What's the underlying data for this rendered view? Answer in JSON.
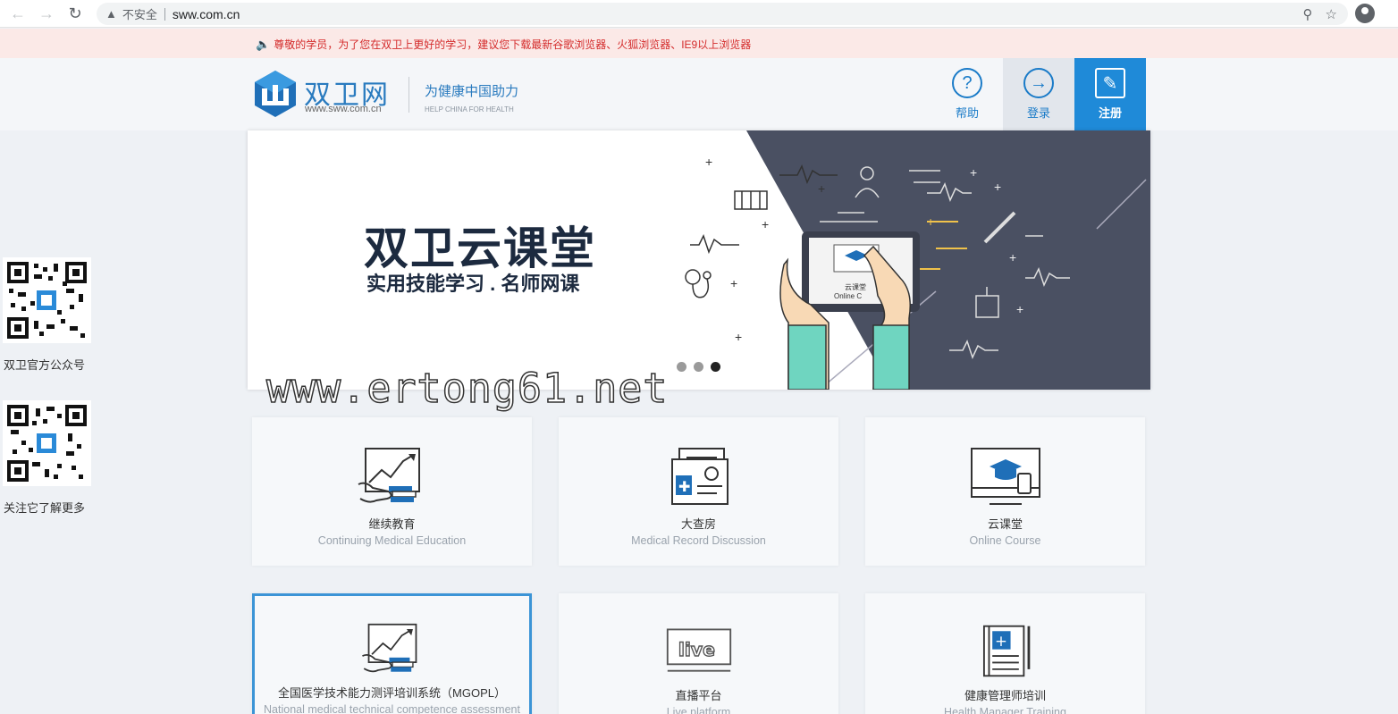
{
  "browser": {
    "insecure_label": "不安全",
    "url": "sww.com.cn"
  },
  "notice": {
    "text": "尊敬的学员，为了您在双卫上更好的学习，建议您下载最新谷歌浏览器、火狐浏览器、IE9以上浏览器"
  },
  "header": {
    "logo_name": "双卫网",
    "logo_url": "www.sww.com.cn",
    "slogan": "为健康中国助力",
    "slogan_en": "HELP CHINA FOR HEALTH",
    "buttons": {
      "help": "帮助",
      "login": "登录",
      "register": "注册"
    }
  },
  "banner": {
    "title": "双卫云课堂",
    "subtitle": "实用技能学习 . 名师网课",
    "tablet_label": "云课堂",
    "tablet_label_en": "Online C",
    "slide_count": 3,
    "active_slide": 3
  },
  "watermark": "www.ertong61.net",
  "sidebar": {
    "qr1_label": "双卫官方公众号",
    "qr2_label": "关注它了解更多"
  },
  "cards": [
    {
      "title": "继续教育",
      "subtitle": "Continuing Medical Education",
      "icon": "chart-hand-books-icon"
    },
    {
      "title": "大查房",
      "subtitle": "Medical Record Discussion",
      "icon": "medical-record-icon"
    },
    {
      "title": "云课堂",
      "subtitle": "Online Course",
      "icon": "monitor-graduation-cap-icon"
    },
    {
      "title": "全国医学技术能力测评培训系统（MGOPL）",
      "subtitle": "National medical technical competence assessment",
      "icon": "chart-hand-books-icon"
    },
    {
      "title": "直播平台",
      "subtitle": "Live platform",
      "icon": "live-tv-icon"
    },
    {
      "title": "健康管理师培训",
      "subtitle": "Health Manager Training",
      "icon": "health-notebook-icon"
    }
  ],
  "colors": {
    "accent": "#1f8ad8",
    "notice_bg": "#fbe9e7",
    "notice_text": "#d42b2b",
    "banner_dark": "#4a5062"
  }
}
